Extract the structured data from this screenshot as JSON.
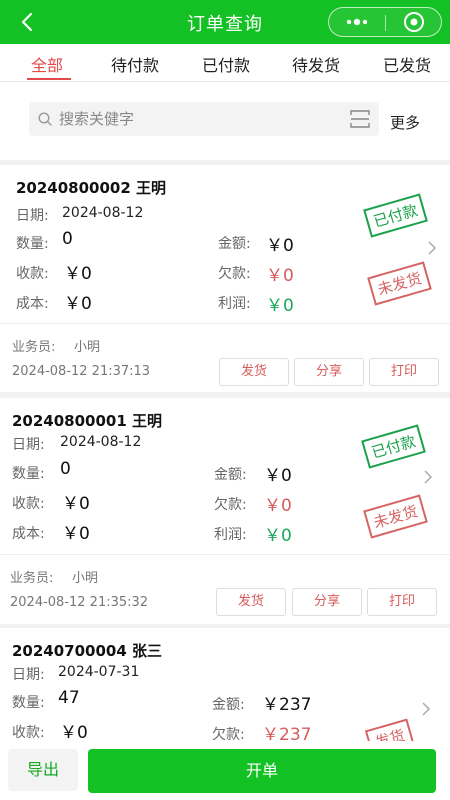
{
  "header": {
    "title": "订单查询"
  },
  "tabs": [
    {
      "label": "全部",
      "active": true
    },
    {
      "label": "待付款"
    },
    {
      "label": "已付款"
    },
    {
      "label": "待发货"
    },
    {
      "label": "已发货"
    }
  ],
  "search": {
    "placeholder": "搜索关健字",
    "more_label": "更多"
  },
  "orders": [
    {
      "title": "20240800002 王明",
      "date_label": "日期:",
      "date": "2024-08-12",
      "qty_label": "数量:",
      "qty": "0",
      "amount_label": "金额:",
      "amount": "￥0",
      "received_label": "收款:",
      "received": "￥0",
      "owed_label": "欠款:",
      "owed": "￥0",
      "cost_label": "成本:",
      "cost": "￥0",
      "profit_label": "利润:",
      "profit": "￥0",
      "stamp_paid": "已付款",
      "stamp_ship": "未发货",
      "salesman_label": "业务员:",
      "salesman": "小明",
      "time": "2024-08-12 21:37:13",
      "actions": [
        "发货",
        "分享",
        "打印"
      ]
    },
    {
      "title": "20240800001 王明",
      "date_label": "日期:",
      "date": "2024-08-12",
      "qty_label": "数量:",
      "qty": "0",
      "amount_label": "金额:",
      "amount": "￥0",
      "received_label": "收款:",
      "received": "￥0",
      "owed_label": "欠款:",
      "owed": "￥0",
      "cost_label": "成本:",
      "cost": "￥0",
      "profit_label": "利润:",
      "profit": "￥0",
      "stamp_paid": "已付款",
      "stamp_ship": "未发货",
      "salesman_label": "业务员:",
      "salesman": "小明",
      "time": "2024-08-12 21:35:32",
      "actions": [
        "发货",
        "分享",
        "打印"
      ]
    },
    {
      "title": "20240700004 张三",
      "date_label": "日期:",
      "date": "2024-07-31",
      "qty_label": "数量:",
      "qty": "47",
      "amount_label": "金额:",
      "amount": "￥237",
      "received_label": "收款:",
      "received": "￥0",
      "owed_label": "欠款:",
      "owed": "￥237",
      "stamp_ship": "发货"
    }
  ],
  "bottom": {
    "export_label": "导出",
    "open_label": "开单"
  },
  "colors": {
    "brand": "#14c124",
    "accent_red": "#e04a4a",
    "profit_green": "#19a85a"
  }
}
